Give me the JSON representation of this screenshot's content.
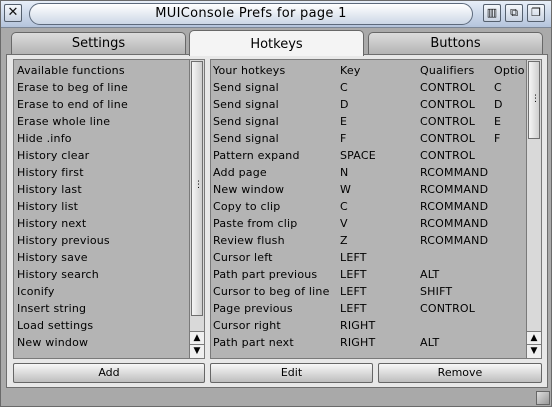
{
  "window": {
    "title": "MUIConsole Prefs for page 1"
  },
  "titlebar": {
    "close_glyph": "✕",
    "iconify_glyph": "▥",
    "zoom_glyph": "⧉",
    "depth_glyph": "❐"
  },
  "tabs": [
    {
      "label": "Settings",
      "active": false
    },
    {
      "label": "Hotkeys",
      "active": true
    },
    {
      "label": "Buttons",
      "active": false
    }
  ],
  "functions_list": {
    "header": "Available functions",
    "items": [
      "Erase to beg of line",
      "Erase to end of line",
      "Erase whole line",
      "Hide .info",
      "History clear",
      "History first",
      "History last",
      "History list",
      "History next",
      "History previous",
      "History save",
      "History search",
      "Iconify",
      "Insert string",
      "Load settings",
      "New window"
    ]
  },
  "hotkeys_table": {
    "columns": [
      "Your hotkeys",
      "Key",
      "Qualifiers",
      "Optio"
    ],
    "rows": [
      [
        "Send signal",
        "C",
        "CONTROL",
        "C"
      ],
      [
        "Send signal",
        "D",
        "CONTROL",
        "D"
      ],
      [
        "Send signal",
        "E",
        "CONTROL",
        "E"
      ],
      [
        "Send signal",
        "F",
        "CONTROL",
        "F"
      ],
      [
        "Pattern expand",
        "SPACE",
        "CONTROL",
        ""
      ],
      [
        "Add page",
        "N",
        "RCOMMAND",
        ""
      ],
      [
        "New window",
        "W",
        "RCOMMAND",
        ""
      ],
      [
        "Copy to clip",
        "C",
        "RCOMMAND",
        ""
      ],
      [
        "Paste from clip",
        "V",
        "RCOMMAND",
        ""
      ],
      [
        "Review flush",
        "Z",
        "RCOMMAND",
        ""
      ],
      [
        "Cursor left",
        "LEFT",
        "",
        ""
      ],
      [
        "Path part previous",
        "LEFT",
        "ALT",
        ""
      ],
      [
        "Cursor to beg of line",
        "LEFT",
        "SHIFT",
        ""
      ],
      [
        "Page previous",
        "LEFT",
        "CONTROL",
        ""
      ],
      [
        "Cursor right",
        "RIGHT",
        "",
        ""
      ],
      [
        "Path part next",
        "RIGHT",
        "ALT",
        ""
      ]
    ]
  },
  "buttons": {
    "add": "Add",
    "edit": "Edit",
    "remove": "Remove"
  },
  "scroll_glyphs": {
    "up": "▲",
    "down": "▼",
    "grip": "⋮"
  }
}
